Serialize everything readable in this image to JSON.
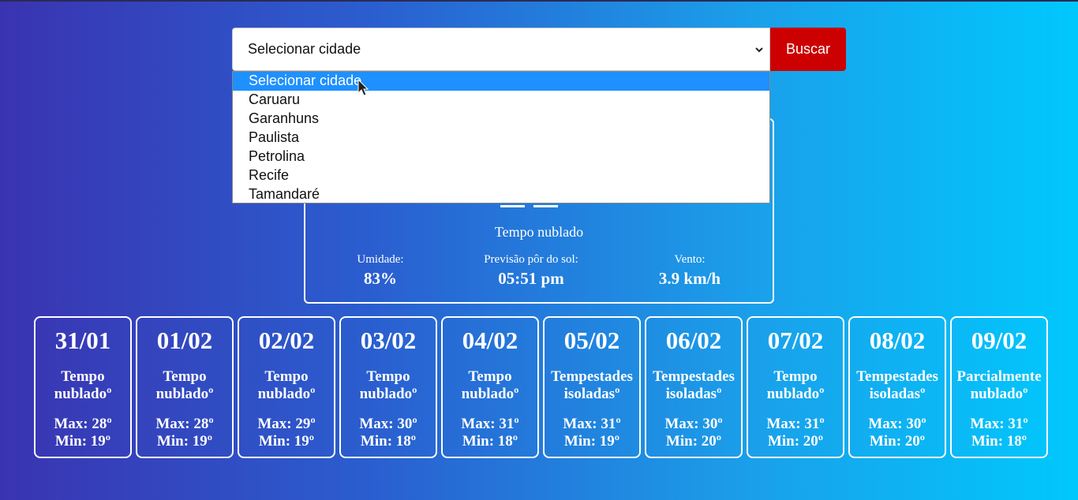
{
  "search": {
    "select_value": "Selecionar cidade",
    "button_label": "Buscar",
    "options": [
      "Selecionar cidade",
      "Caruaru",
      "Garanhuns",
      "Paulista",
      "Petrolina",
      "Recife",
      "Tamandaré"
    ],
    "highlighted_option": "Selecionar cidade"
  },
  "current": {
    "description": "Tempo nublado",
    "humidity_label": "Umidade:",
    "humidity_value": "83%",
    "sunset_label": "Previsão pôr do sol:",
    "sunset_value": "05:51 pm",
    "wind_label": "Vento:",
    "wind_value": "3.9 km/h"
  },
  "forecast": [
    {
      "date": "31/01",
      "desc1": "Tempo",
      "desc2": "nubladoº",
      "max": "Max: 28º",
      "min": "Min: 19º"
    },
    {
      "date": "01/02",
      "desc1": "Tempo",
      "desc2": "nubladoº",
      "max": "Max: 28º",
      "min": "Min: 19º"
    },
    {
      "date": "02/02",
      "desc1": "Tempo",
      "desc2": "nubladoº",
      "max": "Max: 29º",
      "min": "Min: 19º"
    },
    {
      "date": "03/02",
      "desc1": "Tempo",
      "desc2": "nubladoº",
      "max": "Max: 30º",
      "min": "Min: 18º"
    },
    {
      "date": "04/02",
      "desc1": "Tempo",
      "desc2": "nubladoº",
      "max": "Max: 31º",
      "min": "Min: 18º"
    },
    {
      "date": "05/02",
      "desc1": "Tempestades",
      "desc2": "isoladasº",
      "max": "Max: 31º",
      "min": "Min: 19º"
    },
    {
      "date": "06/02",
      "desc1": "Tempestades",
      "desc2": "isoladasº",
      "max": "Max: 30º",
      "min": "Min: 20º"
    },
    {
      "date": "07/02",
      "desc1": "Tempo",
      "desc2": "nubladoº",
      "max": "Max: 31º",
      "min": "Min: 20º"
    },
    {
      "date": "08/02",
      "desc1": "Tempestades",
      "desc2": "isoladasº",
      "max": "Max: 30º",
      "min": "Min: 20º"
    },
    {
      "date": "09/02",
      "desc1": "Parcialmente",
      "desc2": "nubladoº",
      "max": "Max: 31º",
      "min": "Min: 18º"
    }
  ],
  "colors": {
    "button": "#cc0000",
    "highlight": "#1e90ff",
    "gradient_start": "#3a33b1",
    "gradient_end": "#00c8fd"
  },
  "icons": {
    "select_chevron": "chevron-down-icon",
    "cursor": "mouse-pointer-icon"
  }
}
